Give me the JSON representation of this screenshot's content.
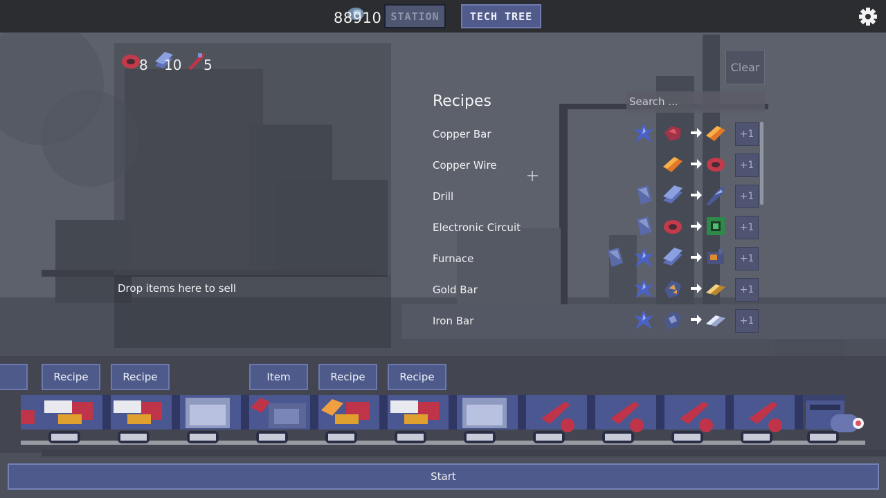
{
  "topbar": {
    "money": "88910",
    "station_label": "STATION",
    "tech_tree_label": "TECH TREE"
  },
  "inventory": [
    {
      "icon": "copper-wire-icon",
      "count": "8"
    },
    {
      "icon": "iron-plate-icon",
      "count": "10"
    },
    {
      "icon": "drill-icon",
      "count": "5"
    }
  ],
  "sell_zone": {
    "label": "Drop items here to sell"
  },
  "recipes": {
    "title": "Recipes",
    "search_placeholder": "Search ...",
    "clear_label": "Clear",
    "add_label": "+1",
    "rows": [
      {
        "name": "Copper Bar",
        "inputs": [
          "crystal-ore-icon",
          "copper-ore-icon"
        ],
        "output": "copper-bar-icon"
      },
      {
        "name": "Copper Wire",
        "inputs": [
          "copper-bar-icon"
        ],
        "output": "copper-wire-icon"
      },
      {
        "name": "Drill",
        "inputs": [
          "plate-icon",
          "iron-plate-icon"
        ],
        "output": "drill-icon"
      },
      {
        "name": "Electronic Circuit",
        "inputs": [
          "plate-icon",
          "copper-wire-icon"
        ],
        "output": "circuit-icon"
      },
      {
        "name": "Furnace",
        "inputs": [
          "plate-icon",
          "crystal-ore-icon",
          "iron-plate-icon"
        ],
        "output": "furnace-icon"
      },
      {
        "name": "Gold Bar",
        "inputs": [
          "crystal-ore-icon",
          "gold-ore-icon"
        ],
        "output": "gold-bar-icon"
      },
      {
        "name": "Iron Bar",
        "inputs": [
          "crystal-ore-icon",
          "iron-ore-icon"
        ],
        "output": "iron-bar-icon"
      }
    ]
  },
  "train": {
    "slot_buttons": [
      "Recipe",
      "Recipe",
      "Item",
      "Recipe",
      "Recipe"
    ],
    "cars": [
      "smelter-car",
      "smelter-car",
      "assembler-car",
      "furnace-car",
      "smelter-car",
      "smelter-car",
      "assembler-car",
      "drill-car",
      "drill-car",
      "drill-car",
      "drill-car",
      "locomotive"
    ]
  },
  "start_label": "Start",
  "colors": {
    "accent": "#4e5a8c",
    "topbar": "#2c2d31",
    "panel": "#46484f"
  }
}
